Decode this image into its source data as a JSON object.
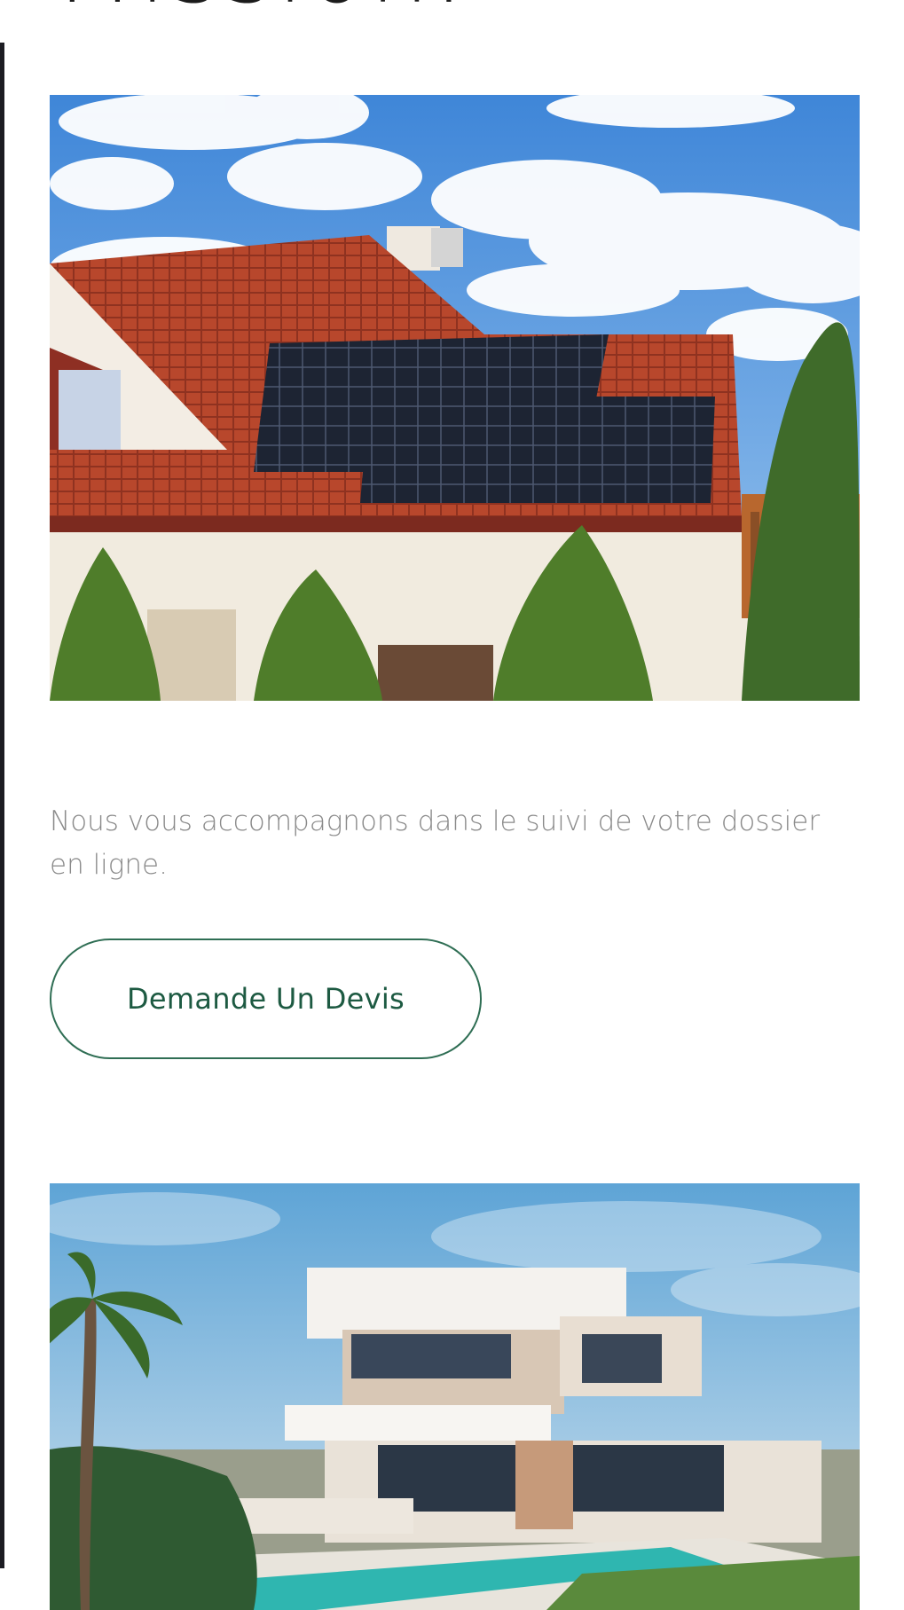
{
  "section": {
    "heading": "Mission.",
    "intro": "Nous vous accompagnons dans le suivi de votre dossier en ligne.",
    "cta_label": "Demande Un Devis"
  },
  "images": [
    {
      "name": "house-with-solar-panels-photo",
      "subject": "solar-roof-house"
    },
    {
      "name": "modern-villa-with-pool-photo",
      "subject": "villa-pool"
    }
  ],
  "colors": {
    "accent": "#2f6e54",
    "text_muted": "#8a8a8a",
    "heading": "#1b1b1b",
    "rule": "#1c1c22"
  }
}
